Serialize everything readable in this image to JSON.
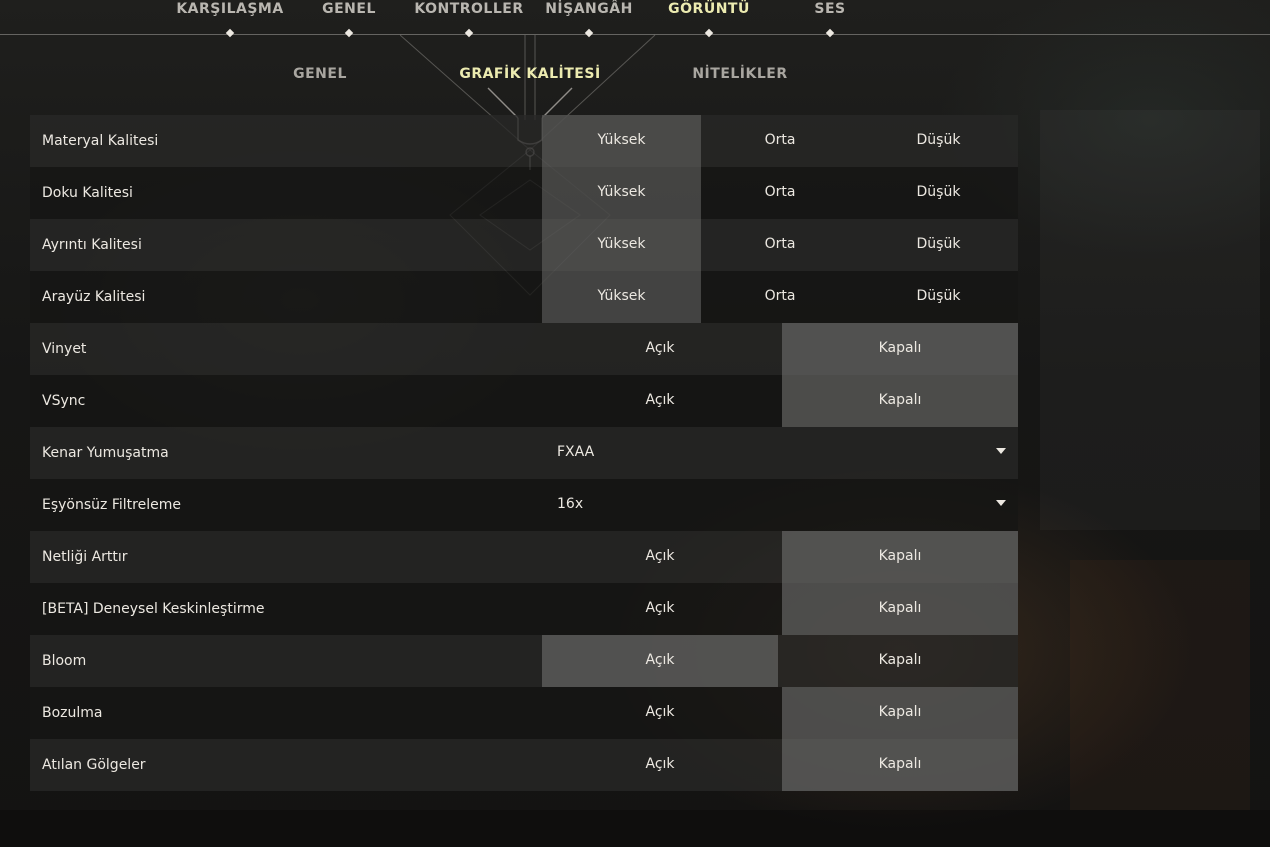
{
  "topnav": {
    "tabs": [
      {
        "label": "KARŞILAŞMA"
      },
      {
        "label": "GENEL"
      },
      {
        "label": "KONTROLLER"
      },
      {
        "label": "NİŞANGÂH"
      },
      {
        "label": "GÖRÜNTÜ"
      },
      {
        "label": "SES"
      }
    ],
    "active": "GÖRÜNTÜ"
  },
  "subnav": {
    "tabs": [
      {
        "label": "GENEL"
      },
      {
        "label": "GRAFİK KALİTESİ"
      },
      {
        "label": "NİTELİKLER"
      }
    ],
    "active": "GRAFİK KALİTESİ"
  },
  "settings": [
    {
      "label": "Materyal Kalitesi",
      "options": [
        "Yüksek",
        "Orta",
        "Düşük"
      ],
      "selected": "Yüksek"
    },
    {
      "label": "Doku Kalitesi",
      "options": [
        "Yüksek",
        "Orta",
        "Düşük"
      ],
      "selected": "Yüksek"
    },
    {
      "label": "Ayrıntı Kalitesi",
      "options": [
        "Yüksek",
        "Orta",
        "Düşük"
      ],
      "selected": "Yüksek"
    },
    {
      "label": "Arayüz Kalitesi",
      "options": [
        "Yüksek",
        "Orta",
        "Düşük"
      ],
      "selected": "Yüksek"
    },
    {
      "label": "Vinyet",
      "options": [
        "Açık",
        "Kapalı"
      ],
      "selected": "Kapalı"
    },
    {
      "label": "VSync",
      "options": [
        "Açık",
        "Kapalı"
      ],
      "selected": "Kapalı"
    },
    {
      "label": "Kenar Yumuşatma",
      "value": "FXAA"
    },
    {
      "label": "Eşyönsüz Filtreleme",
      "value": "16x"
    },
    {
      "label": "Netliği Arttır",
      "options": [
        "Açık",
        "Kapalı"
      ],
      "selected": "Kapalı"
    },
    {
      "label": "[BETA] Deneysel Keskinleştirme",
      "options": [
        "Açık",
        "Kapalı"
      ],
      "selected": "Kapalı"
    },
    {
      "label": "Bloom",
      "options": [
        "Açık",
        "Kapalı"
      ],
      "selected": "Açık"
    },
    {
      "label": "Bozulma",
      "options": [
        "Açık",
        "Kapalı"
      ],
      "selected": "Kapalı"
    },
    {
      "label": "Atılan Gölgeler",
      "options": [
        "Açık",
        "Kapalı"
      ],
      "selected": "Kapalı"
    }
  ],
  "colors": {
    "accent": "#ecebb0",
    "text": "#ece8e1",
    "selected": "#5f5f5d"
  }
}
